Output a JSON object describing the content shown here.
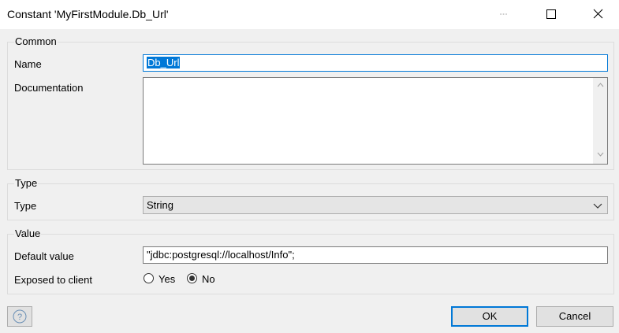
{
  "window": {
    "title": "Constant 'MyFirstModule.Db_Url'"
  },
  "common": {
    "group_label": "Common",
    "name_label": "Name",
    "name_value": "Db_Url",
    "documentation_label": "Documentation",
    "documentation_value": ""
  },
  "type": {
    "group_label": "Type",
    "type_label": "Type",
    "type_value": "String"
  },
  "value": {
    "group_label": "Value",
    "default_label": "Default value",
    "default_value": "\"jdbc:postgresql://localhost/Info\";",
    "exposed_label": "Exposed to client",
    "yes_label": "Yes",
    "no_label": "No",
    "exposed_selected": "No"
  },
  "footer": {
    "ok_label": "OK",
    "cancel_label": "Cancel"
  },
  "colors": {
    "accent": "#0078d7",
    "background": "#f0f0f0"
  },
  "icons": [
    "minimize-icon",
    "maximize-icon",
    "close-icon",
    "help-icon",
    "chevron-down-icon",
    "scroll-up-icon",
    "scroll-down-icon"
  ]
}
